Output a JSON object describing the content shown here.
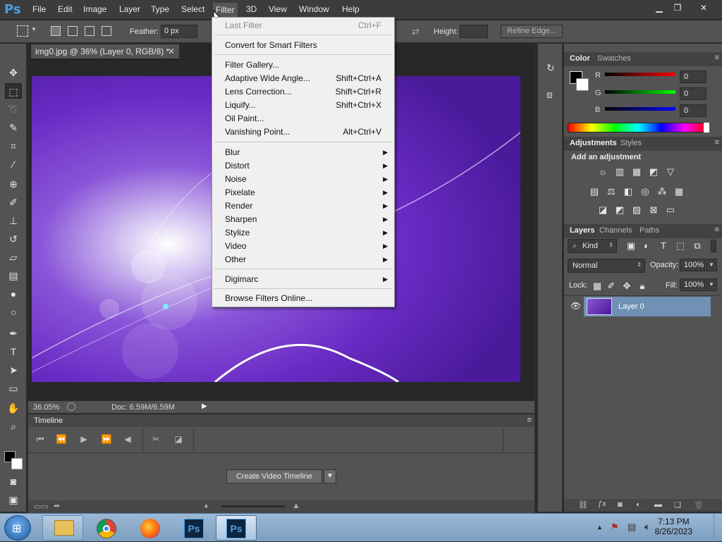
{
  "app": {
    "logo": "Ps"
  },
  "menubar": {
    "items": [
      "File",
      "Edit",
      "Image",
      "Layer",
      "Type",
      "Select",
      "Filter",
      "3D",
      "View",
      "Window",
      "Help"
    ],
    "active": "Filter"
  },
  "options": {
    "feather_label": "Feather:",
    "feather_value": "0 px",
    "height_label": "Height:",
    "refine_edge_label": "Refine Edge..."
  },
  "document": {
    "tab_title": "img0.jpg @ 36% (Layer 0, RGB/8) *",
    "zoom": "36.05%",
    "doc_info": "Doc: 6.59M/6.59M"
  },
  "filter_menu": {
    "group1": [
      {
        "label": "Last Filter",
        "shortcut": "Ctrl+F",
        "disabled": true
      },
      {
        "label": "Convert for Smart Filters",
        "shortcut": ""
      }
    ],
    "group2": [
      {
        "label": "Filter Gallery...",
        "shortcut": ""
      },
      {
        "label": "Adaptive Wide Angle...",
        "shortcut": "Shift+Ctrl+A"
      },
      {
        "label": "Lens Correction...",
        "shortcut": "Shift+Ctrl+R"
      },
      {
        "label": "Liquify...",
        "shortcut": "Shift+Ctrl+X"
      },
      {
        "label": "Oil Paint...",
        "shortcut": ""
      },
      {
        "label": "Vanishing Point...",
        "shortcut": "Alt+Ctrl+V"
      }
    ],
    "submenus": [
      "Blur",
      "Distort",
      "Noise",
      "Pixelate",
      "Render",
      "Sharpen",
      "Stylize",
      "Video",
      "Other"
    ],
    "digimarc": "Digimarc",
    "browse": "Browse Filters Online..."
  },
  "timeline": {
    "title": "Timeline",
    "create_button": "Create Video Timeline"
  },
  "color_panel": {
    "tabs": [
      "Color",
      "Swatches"
    ],
    "r_label": "R",
    "g_label": "G",
    "b_label": "B",
    "r_value": "0",
    "g_value": "0",
    "b_value": "0"
  },
  "adjustments_panel": {
    "tabs": [
      "Adjustments",
      "Styles"
    ],
    "heading": "Add an adjustment"
  },
  "layers_panel": {
    "tabs": [
      "Layers",
      "Channels",
      "Paths"
    ],
    "kind_label": "Kind",
    "blend_mode": "Normal",
    "opacity_label": "Opacity:",
    "opacity_value": "100%",
    "lock_label": "Lock:",
    "fill_label": "Fill:",
    "fill_value": "100%",
    "layers": [
      {
        "name": "Layer 0"
      }
    ]
  },
  "taskbar": {
    "time": "7:13 PM",
    "date": "8/26/2023"
  },
  "colors": {
    "canvas_purple": "#6a2bc4",
    "selection_highlight": "#7090b4",
    "ps_blue": "#4a9fe0"
  }
}
